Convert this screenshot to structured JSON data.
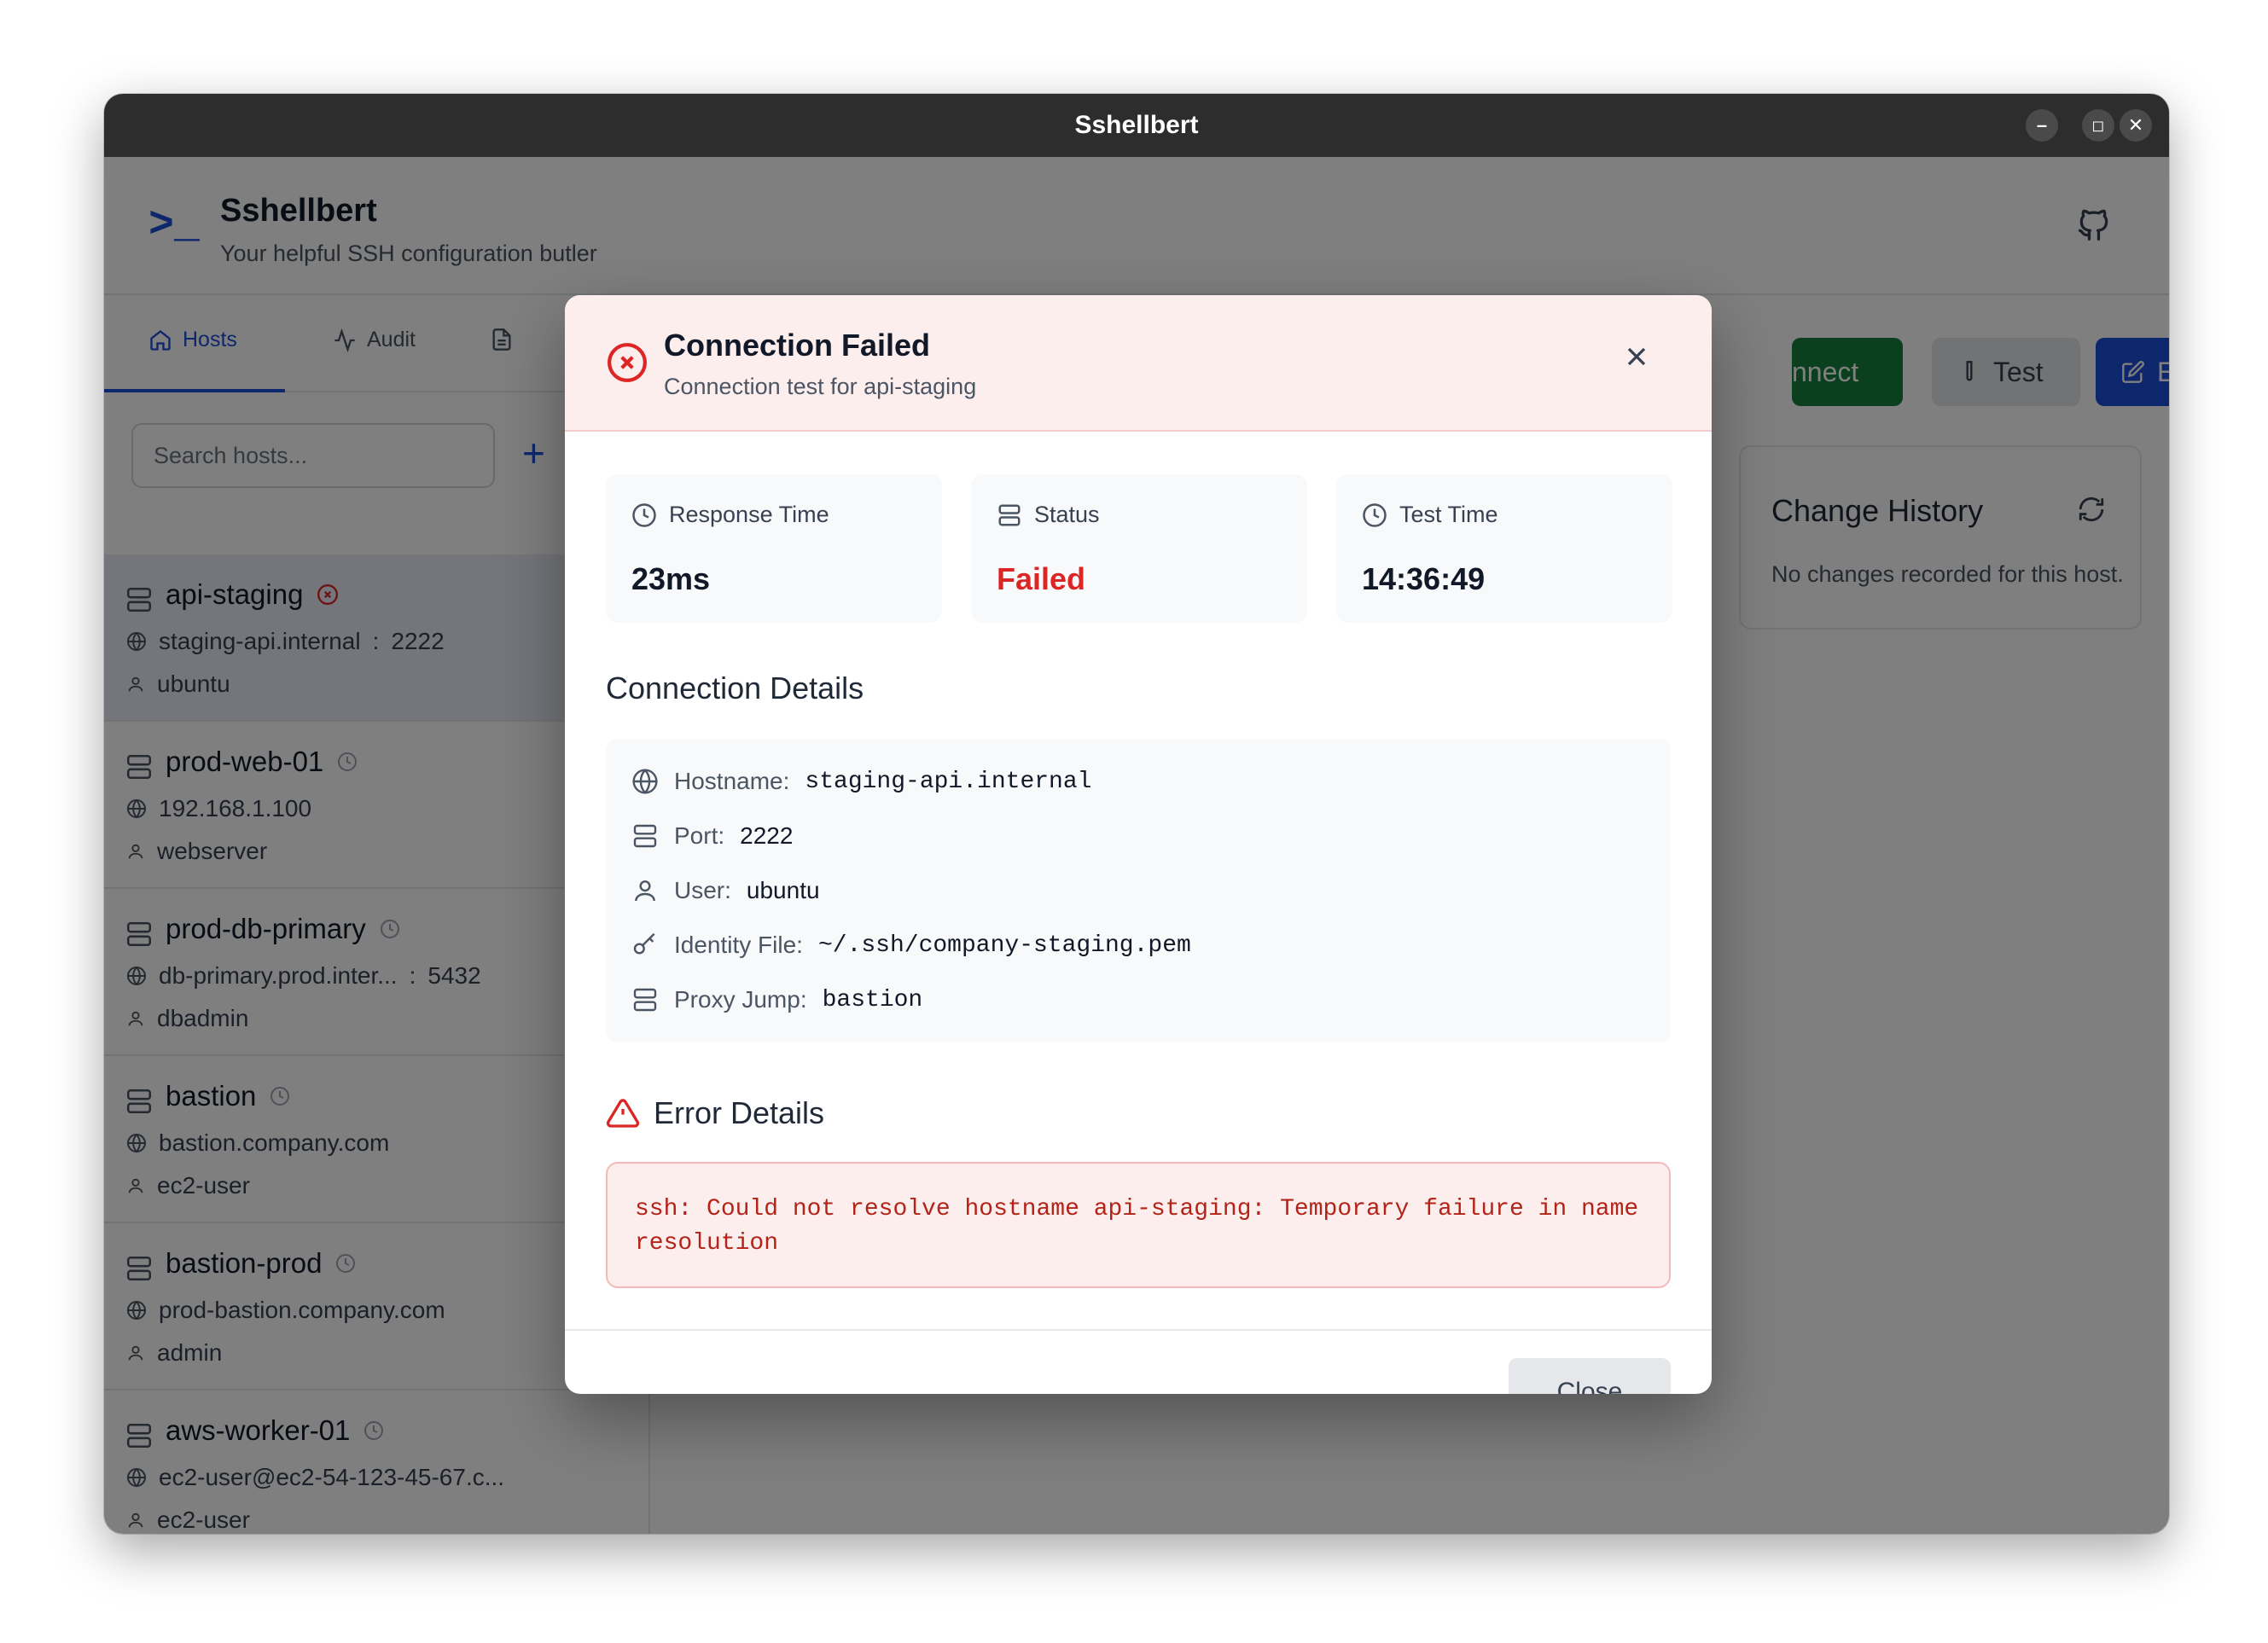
{
  "window": {
    "title": "Sshellbert",
    "controls": {
      "minimize": "–",
      "maximize": "◻",
      "close": "✕"
    }
  },
  "header": {
    "prompt_glyph": ">_",
    "app_name": "Sshellbert",
    "tagline": "Your helpful SSH configuration butler"
  },
  "tabs": [
    {
      "label": "Hosts",
      "active": true
    },
    {
      "label": "Audit",
      "active": false
    },
    {
      "label": "",
      "active": false
    }
  ],
  "search": {
    "placeholder": "Search hosts..."
  },
  "add_glyph": "+",
  "hosts": [
    {
      "name": "api-staging",
      "host": "staging-api.internal",
      "port": "2222",
      "user": "ubuntu",
      "status": "error",
      "selected": true
    },
    {
      "name": "prod-web-01",
      "host": "192.168.1.100",
      "port": "",
      "user": "webserver",
      "status": "unknown"
    },
    {
      "name": "prod-db-primary",
      "host": "db-primary.prod.inter...",
      "port": "5432",
      "user": "dbadmin",
      "status": "unknown"
    },
    {
      "name": "bastion",
      "host": "bastion.company.com",
      "port": "",
      "user": "ec2-user",
      "status": "unknown"
    },
    {
      "name": "bastion-prod",
      "host": "prod-bastion.company.com",
      "port": "",
      "user": "admin",
      "status": "unknown"
    },
    {
      "name": "aws-worker-01",
      "host": "ec2-user@ec2-54-123-45-67.c...",
      "port": "",
      "user": "ec2-user",
      "status": "unknown"
    }
  ],
  "port_separator": ":",
  "toolbar": {
    "connect_label": "nnect",
    "test_label": "Test",
    "edit_label": "Edit"
  },
  "history": {
    "title": "Change History",
    "empty": "No changes recorded for this host."
  },
  "dialog": {
    "title": "Connection Failed",
    "subtitle": "Connection test for api-staging",
    "stats": {
      "response": {
        "label": "Response Time",
        "value": "23ms"
      },
      "status": {
        "label": "Status",
        "value": "Failed"
      },
      "time": {
        "label": "Test Time",
        "value": "14:36:49"
      }
    },
    "details_title": "Connection Details",
    "details": {
      "hostname": {
        "label": "Hostname:",
        "value": "staging-api.internal"
      },
      "port": {
        "label": "Port:",
        "value": "2222"
      },
      "user": {
        "label": "User:",
        "value": "ubuntu"
      },
      "identity": {
        "label": "Identity File:",
        "value": "~/.ssh/company-staging.pem"
      },
      "proxy": {
        "label": "Proxy Jump:",
        "value": "bastion"
      }
    },
    "error_title": "Error Details",
    "error_message": "ssh: Could not resolve hostname api-staging: Temporary failure in name resolution",
    "close_label": "Close"
  },
  "colors": {
    "accent": "#1d4ed8",
    "danger": "#dc2626",
    "success": "#15803d"
  }
}
